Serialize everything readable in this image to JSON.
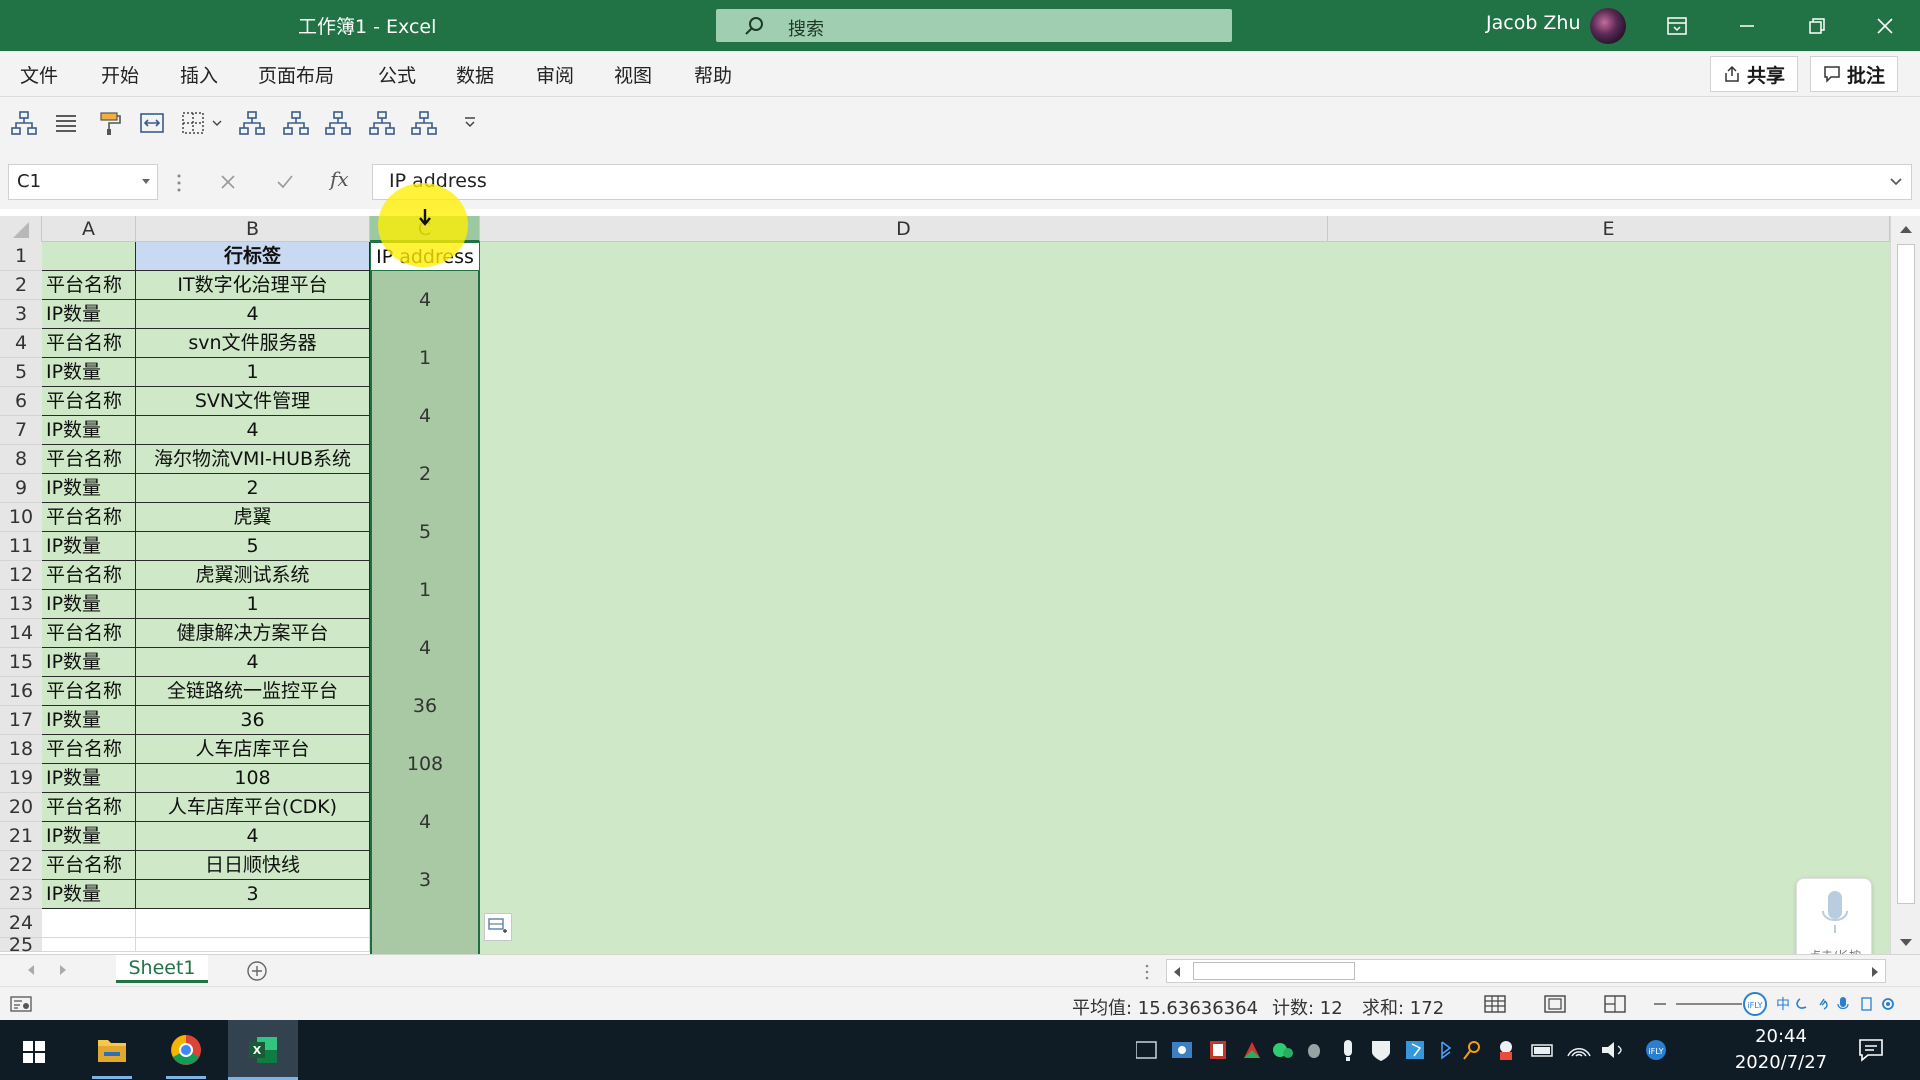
{
  "window": {
    "title": "工作簿1  -  Excel",
    "search_placeholder": "搜索",
    "user": "Jacob Zhu"
  },
  "menu": {
    "items": [
      "文件",
      "开始",
      "插入",
      "页面布局",
      "公式",
      "数据",
      "审阅",
      "视图",
      "帮助"
    ],
    "share_label": "共享",
    "comments_label": "批注"
  },
  "formula_bar": {
    "name_box": "C1",
    "fx_label": "fx",
    "content": "IP address"
  },
  "columns": [
    "A",
    "B",
    "C",
    "D",
    "E"
  ],
  "rows": [
    {
      "n": "1",
      "a": "",
      "b": "行标签",
      "c": "IP address"
    },
    {
      "n": "2",
      "a": "平台名称",
      "b": "IT数字化治理平台",
      "c": "4"
    },
    {
      "n": "3",
      "a": "IP数量",
      "b": "4",
      "c": ""
    },
    {
      "n": "4",
      "a": "平台名称",
      "b": "svn文件服务器",
      "c": "1"
    },
    {
      "n": "5",
      "a": "IP数量",
      "b": "1",
      "c": ""
    },
    {
      "n": "6",
      "a": "平台名称",
      "b": "SVN文件管理",
      "c": "4"
    },
    {
      "n": "7",
      "a": "IP数量",
      "b": "4",
      "c": ""
    },
    {
      "n": "8",
      "a": "平台名称",
      "b": "海尔物流VMI-HUB系统",
      "c": "2"
    },
    {
      "n": "9",
      "a": "IP数量",
      "b": "2",
      "c": ""
    },
    {
      "n": "10",
      "a": "平台名称",
      "b": "虎翼",
      "c": "5"
    },
    {
      "n": "11",
      "a": "IP数量",
      "b": "5",
      "c": ""
    },
    {
      "n": "12",
      "a": "平台名称",
      "b": "虎翼测试系统",
      "c": "1"
    },
    {
      "n": "13",
      "a": "IP数量",
      "b": "1",
      "c": ""
    },
    {
      "n": "14",
      "a": "平台名称",
      "b": "健康解决方案平台",
      "c": "4"
    },
    {
      "n": "15",
      "a": "IP数量",
      "b": "4",
      "c": ""
    },
    {
      "n": "16",
      "a": "平台名称",
      "b": "全链路统一监控平台",
      "c": "36"
    },
    {
      "n": "17",
      "a": "IP数量",
      "b": "36",
      "c": ""
    },
    {
      "n": "18",
      "a": "平台名称",
      "b": "人车店库平台",
      "c": "108"
    },
    {
      "n": "19",
      "a": "IP数量",
      "b": "108",
      "c": ""
    },
    {
      "n": "20",
      "a": "平台名称",
      "b": "人车店库平台(CDK)",
      "c": "4"
    },
    {
      "n": "21",
      "a": "IP数量",
      "b": "4",
      "c": ""
    },
    {
      "n": "22",
      "a": "平台名称",
      "b": "日日顺快线",
      "c": "3"
    },
    {
      "n": "23",
      "a": "IP数量",
      "b": "3",
      "c": ""
    },
    {
      "n": "24",
      "a": "",
      "b": "",
      "c": ""
    },
    {
      "n": "25",
      "a": "",
      "b": "",
      "c": ""
    }
  ],
  "sheet": {
    "tab_name": "Sheet1"
  },
  "status": {
    "average": "平均值: 15.63636364",
    "count": "计数: 12",
    "sum": "求和: 172"
  },
  "mic_widget": {
    "label": "点击/长按"
  },
  "taskbar": {
    "time": "20:44",
    "date": "2020/7/27"
  },
  "colors": {
    "excel_green": "#217346",
    "selection_fill": "#cfe8c7",
    "selected_column": "#a9c9a4"
  }
}
